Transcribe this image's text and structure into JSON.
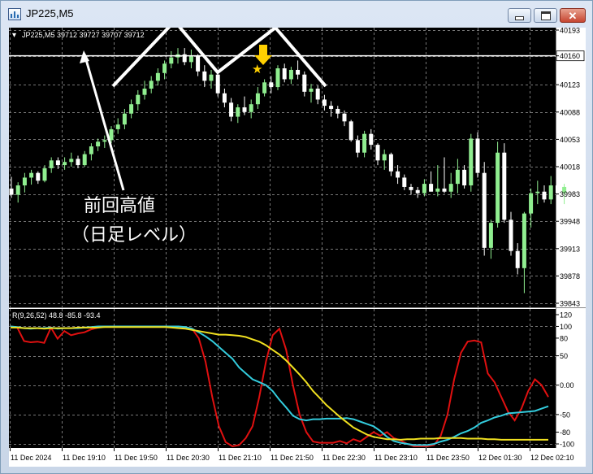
{
  "window": {
    "title": "JP225,M5"
  },
  "chart_header": {
    "text": "JP225,M5  39712 39727 39707 39712"
  },
  "annotation": {
    "line1": "前回高値",
    "line2": "（日足レベル）"
  },
  "colors": {
    "background": "#000000",
    "up_candle": "#90ee90",
    "down_candle": "#ffffff",
    "grid": "#777777",
    "red_line": "#e01010",
    "cyan_line": "#33ccdd",
    "yellow_line": "#f0e020"
  },
  "price_axis": {
    "ticks": [
      "40193",
      "40160",
      "40123",
      "40088",
      "40053",
      "40018",
      "39983",
      "39948",
      "39913",
      "39878",
      "39843"
    ],
    "highlighted_level": "40160"
  },
  "indicator": {
    "label": "R(9,26,52) 48.8 -85.8 -93.4",
    "ticks": [
      "120",
      "100",
      "80",
      "50",
      "0.00",
      "-50",
      "-80",
      "-100"
    ]
  },
  "time_axis": {
    "labels": [
      "11 Dec 2024",
      "11 Dec 19:10",
      "11 Dec 19:50",
      "11 Dec 20:30",
      "11 Dec 21:10",
      "11 Dec 21:50",
      "11 Dec 22:30",
      "11 Dec 23:10",
      "11 Dec 23:50",
      "12 Dec 01:30",
      "12 Dec 02:10"
    ]
  },
  "chart_data": {
    "type": "candlestick",
    "symbol": "JP225",
    "timeframe": "M5",
    "price_ylim": [
      39830,
      40205
    ],
    "resistance_level": 40160,
    "candles": [
      [
        39990,
        40005,
        39978,
        39982
      ],
      [
        39982,
        39998,
        39972,
        39994
      ],
      [
        39994,
        40010,
        39985,
        40004
      ],
      [
        40004,
        40014,
        39995,
        40010
      ],
      [
        40010,
        40012,
        39996,
        40000
      ],
      [
        40000,
        40020,
        39998,
        40016
      ],
      [
        40016,
        40030,
        40010,
        40026
      ],
      [
        40026,
        40030,
        40015,
        40020
      ],
      [
        40020,
        40030,
        40014,
        40024
      ],
      [
        40024,
        40036,
        40018,
        40028
      ],
      [
        40028,
        40032,
        40016,
        40020
      ],
      [
        40020,
        40038,
        40018,
        40034
      ],
      [
        40034,
        40048,
        40026,
        40044
      ],
      [
        40044,
        40054,
        40038,
        40050
      ],
      [
        40050,
        40058,
        40042,
        40052
      ],
      [
        40052,
        40070,
        40048,
        40066
      ],
      [
        40066,
        40080,
        40060,
        40072
      ],
      [
        40072,
        40092,
        40066,
        40086
      ],
      [
        40086,
        40104,
        40080,
        40098
      ],
      [
        40098,
        40116,
        40090,
        40110
      ],
      [
        40110,
        40128,
        40104,
        40118
      ],
      [
        40118,
        40134,
        40112,
        40128
      ],
      [
        40128,
        40144,
        40122,
        40138
      ],
      [
        40138,
        40154,
        40130,
        40150
      ],
      [
        40150,
        40166,
        40144,
        40158
      ],
      [
        40158,
        40170,
        40150,
        40162
      ],
      [
        40162,
        40170,
        40148,
        40152
      ],
      [
        40152,
        40168,
        40144,
        40160
      ],
      [
        40160,
        40162,
        40134,
        40140
      ],
      [
        40140,
        40148,
        40120,
        40128
      ],
      [
        40128,
        40142,
        40118,
        40136
      ],
      [
        40136,
        40140,
        40108,
        40112
      ],
      [
        40112,
        40118,
        40094,
        40100
      ],
      [
        40100,
        40106,
        40076,
        40082
      ],
      [
        40082,
        40098,
        40074,
        40094
      ],
      [
        40094,
        40108,
        40084,
        40088
      ],
      [
        40088,
        40104,
        40080,
        40098
      ],
      [
        40098,
        40120,
        40092,
        40112
      ],
      [
        40112,
        40130,
        40108,
        40126
      ],
      [
        40126,
        40134,
        40112,
        40120
      ],
      [
        40120,
        40148,
        40116,
        40144
      ],
      [
        40144,
        40150,
        40126,
        40130
      ],
      [
        40130,
        40146,
        40124,
        40142
      ],
      [
        40142,
        40154,
        40130,
        40136
      ],
      [
        40136,
        40140,
        40108,
        40114
      ],
      [
        40114,
        40124,
        40100,
        40118
      ],
      [
        40118,
        40122,
        40098,
        40104
      ],
      [
        40104,
        40110,
        40090,
        40096
      ],
      [
        40096,
        40102,
        40082,
        40092
      ],
      [
        40092,
        40096,
        40080,
        40086
      ],
      [
        40086,
        40090,
        40070,
        40076
      ],
      [
        40076,
        40078,
        40050,
        40052
      ],
      [
        40052,
        40058,
        40030,
        40036
      ],
      [
        40036,
        40064,
        40030,
        40060
      ],
      [
        40060,
        40066,
        40040,
        40046
      ],
      [
        40046,
        40048,
        40020,
        40026
      ],
      [
        40026,
        40040,
        40014,
        40034
      ],
      [
        40034,
        40036,
        40006,
        40012
      ],
      [
        40012,
        40020,
        39996,
        40004
      ],
      [
        40004,
        40008,
        39988,
        39992
      ],
      [
        39992,
        39996,
        39982,
        39988
      ],
      [
        39988,
        39992,
        39978,
        39984
      ],
      [
        39984,
        40002,
        39980,
        39996
      ],
      [
        39996,
        40012,
        39986,
        39986
      ],
      [
        39986,
        40020,
        39980,
        39990
      ],
      [
        39990,
        40030,
        39984,
        39986
      ],
      [
        39986,
        40010,
        39978,
        39996
      ],
      [
        39996,
        40028,
        39984,
        40014
      ],
      [
        40014,
        40020,
        39990,
        39994
      ],
      [
        39994,
        40060,
        39986,
        40054
      ],
      [
        40054,
        40062,
        40004,
        40010
      ],
      [
        40010,
        40024,
        39904,
        39914
      ],
      [
        39914,
        39950,
        39900,
        39946
      ],
      [
        39946,
        40050,
        39940,
        40036
      ],
      [
        40036,
        40048,
        39946,
        39950
      ],
      [
        39950,
        39960,
        39904,
        39910
      ],
      [
        39910,
        39920,
        39880,
        39888
      ],
      [
        39888,
        39960,
        39856,
        39958
      ],
      [
        39958,
        39990,
        39940,
        39984
      ],
      [
        39984,
        40000,
        39970,
        39986
      ],
      [
        39986,
        39994,
        39972,
        39976
      ],
      [
        39976,
        40006,
        39970,
        39994
      ],
      [
        39994,
        40012,
        39982,
        39984
      ],
      [
        39984,
        39996,
        39970,
        39992
      ]
    ],
    "oscillator": {
      "name": "R(9,26,52)",
      "ylim": [
        -110,
        120
      ],
      "series": [
        {
          "name": "9",
          "values": [
            100,
            98,
            75,
            73,
            74,
            72,
            98,
            79,
            92,
            85,
            88,
            90,
            95,
            98,
            100,
            100,
            100,
            100,
            100,
            100,
            100,
            100,
            100,
            100,
            100,
            99,
            98,
            96,
            80,
            40,
            -20,
            -70,
            -97,
            -104,
            -102,
            -90,
            -70,
            -20,
            40,
            85,
            96,
            60,
            0,
            -50,
            -80,
            -96,
            -98,
            -98,
            -98,
            -95,
            -99,
            -92,
            -96,
            -88,
            -80,
            -86,
            -80,
            -90,
            -94,
            -100,
            -104,
            -104,
            -104,
            -102,
            -86,
            -50,
            10,
            55,
            74,
            76,
            73,
            20,
            5,
            -20,
            -45,
            -60,
            -40,
            -10,
            10,
            0,
            -20
          ]
        },
        {
          "name": "26",
          "values": [
            100,
            99,
            97,
            96,
            97,
            97,
            98,
            96,
            97,
            97,
            97,
            98,
            99,
            100,
            100,
            100,
            100,
            100,
            100,
            100,
            100,
            100,
            100,
            100,
            100,
            100,
            99,
            96,
            90,
            83,
            75,
            65,
            55,
            45,
            30,
            20,
            10,
            5,
            0,
            -10,
            -25,
            -38,
            -52,
            -58,
            -60,
            -58,
            -58,
            -57,
            -57,
            -57,
            -56,
            -58,
            -62,
            -66,
            -70,
            -78,
            -88,
            -95,
            -98,
            -100,
            -102,
            -102,
            -102,
            -100,
            -96,
            -93,
            -88,
            -82,
            -78,
            -72,
            -64,
            -60,
            -55,
            -52,
            -48,
            -47,
            -46,
            -45,
            -44,
            -40,
            -36
          ]
        },
        {
          "name": "52",
          "values": [
            98,
            98,
            97,
            97,
            97,
            96,
            97,
            97,
            97,
            97,
            98,
            98,
            98,
            98,
            99,
            99,
            99,
            99,
            99,
            99,
            99,
            99,
            99,
            99,
            98,
            97,
            96,
            94,
            92,
            90,
            88,
            86,
            86,
            85,
            84,
            82,
            78,
            74,
            68,
            60,
            52,
            42,
            30,
            18,
            5,
            -10,
            -22,
            -34,
            -44,
            -54,
            -63,
            -72,
            -78,
            -84,
            -88,
            -90,
            -92,
            -92,
            -93,
            -92,
            -92,
            -91,
            -91,
            -91,
            -90,
            -90,
            -90,
            -90,
            -91,
            -91,
            -91,
            -92,
            -92,
            -93,
            -93,
            -93,
            -93,
            -93,
            -93,
            -93,
            -93
          ]
        }
      ]
    }
  }
}
